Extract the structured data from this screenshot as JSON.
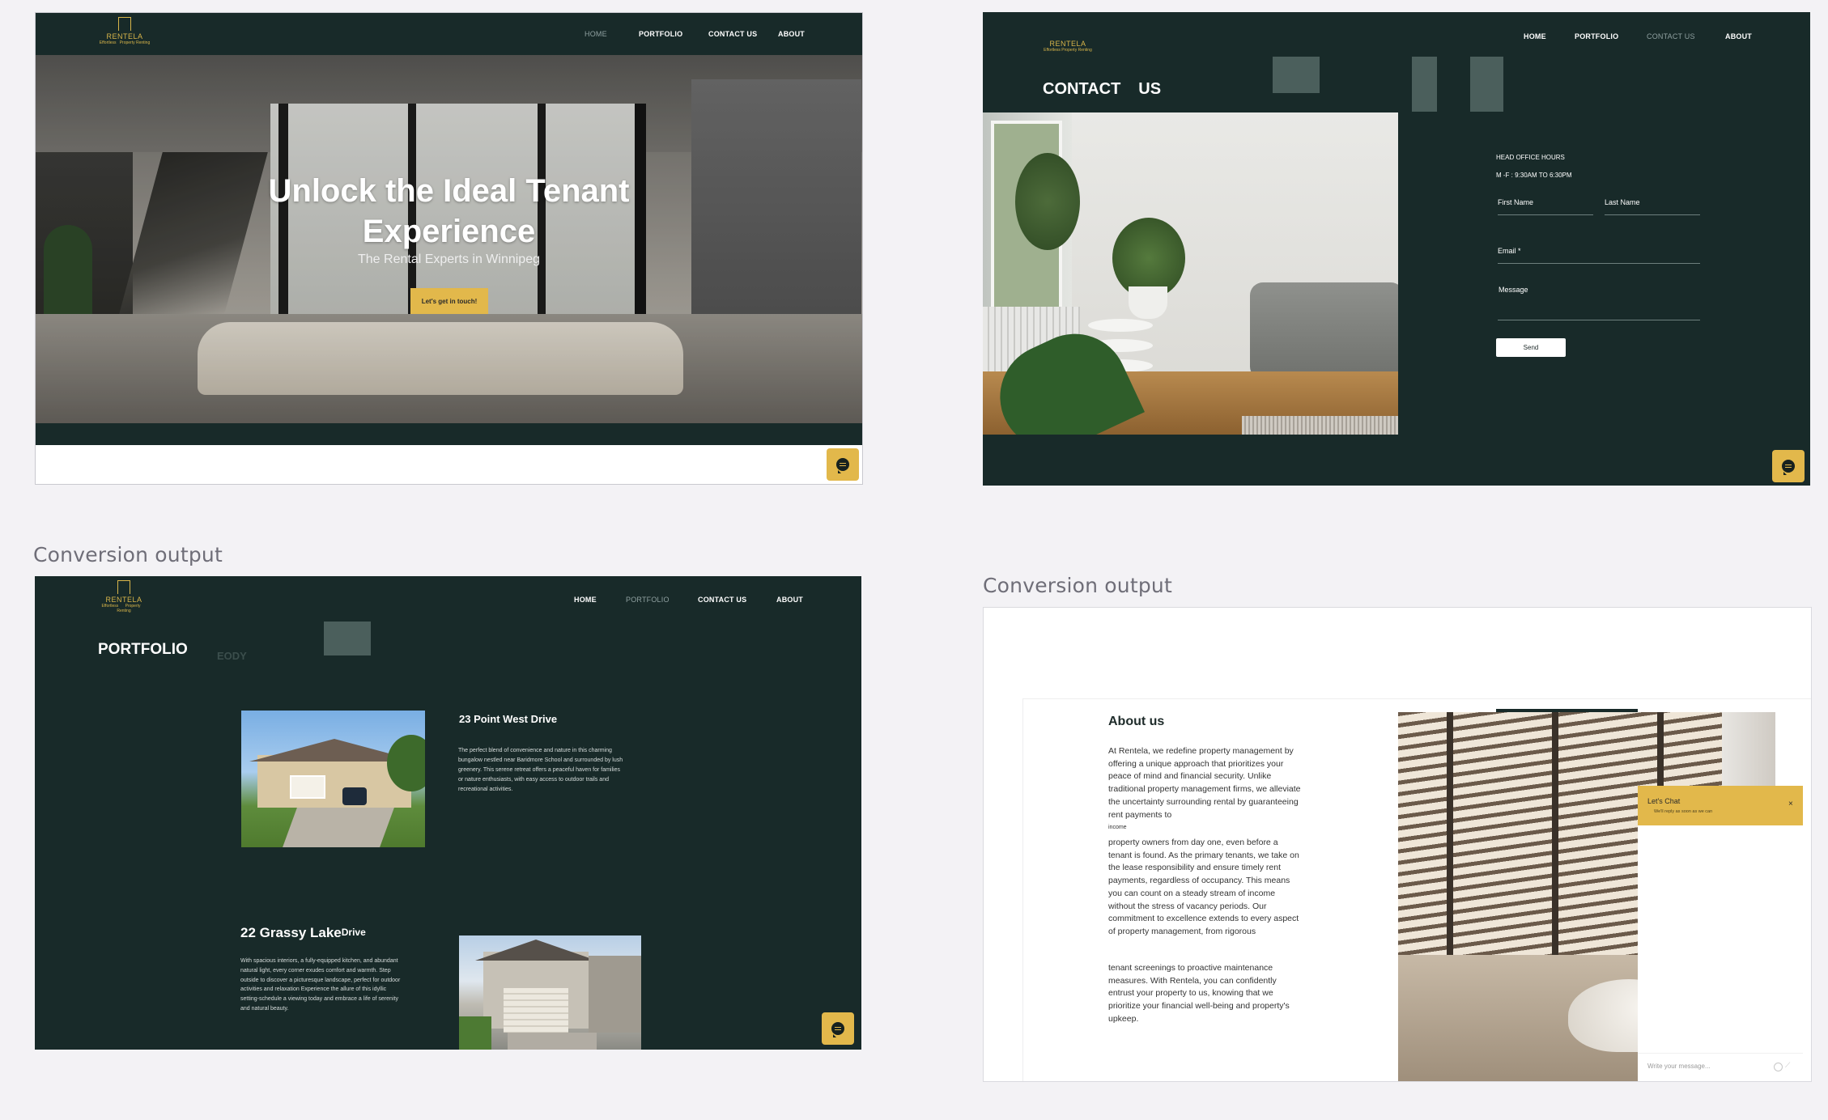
{
  "captions": {
    "bottom_left": "Conversion output",
    "bottom_right": "Conversion output"
  },
  "brand": {
    "name": "RENTELA",
    "tag1": "Effortless",
    "tag2": "Property",
    "tag3": "Renting",
    "tagline": "Effortless Property Renting",
    "gold": "#d8b54a",
    "dark_green": "#182a29"
  },
  "nav": {
    "home": "HOME",
    "portfolio": "PORTFOLIO",
    "contact": "CONTACT US",
    "about": "ABOUT"
  },
  "hero": {
    "title_line1": "Unlock the Ideal Tenant",
    "title_line2": "Experience",
    "subtitle": "The Rental Experts in Winnipeg",
    "cta": "Let's get in touch!"
  },
  "contact": {
    "title_word1": "CONTACT",
    "title_word2": "US",
    "office_hours_title": "HEAD OFFICE HOURS",
    "office_hours": "M -F : 9:30AM TO 6:30PM",
    "first_name": "First Name",
    "last_name": "Last Name",
    "email": "Email *",
    "message": "Message",
    "send": "Send"
  },
  "portfolio": {
    "title": "PORTFOLIO",
    "ghost_text": "EODY",
    "listings": [
      {
        "title": "23 Point West Drive",
        "text": "The perfect blend of convenience and nature in this charming bungalow nestled near Baridmore School and surrounded by lush greenery. This serene retreat offers a peaceful haven for families or nature enthusiasts, with easy access to outdoor trails and recreational activities."
      },
      {
        "title_main": "22 Grassy Lake",
        "title_suffix": "Drive",
        "text": "With spacious interiors, a fully-equipped kitchen, and abundant natural light, every corner exudes comfort and warmth. Step outside to discover a picturesque landscape, perfect for outdoor activities and relaxation Experience the allure of this idyllic setting-schedule a viewing today and embrace a life of serenity and natural beauty."
      }
    ]
  },
  "about": {
    "title": "About us",
    "para1": "At Rentela, we redefine property management by offering a unique approach that prioritizes your peace of mind and financial security. Unlike traditional property management firms, we alleviate the uncertainty surrounding rental by guaranteeing rent payments to",
    "stray": "income",
    "para2": "property owners from day one, even before a tenant is found. As the primary tenants, we take on the lease responsibility and ensure timely rent payments, regardless of occupancy. This means you can count on a steady stream of income without the stress of vacancy periods. Our commitment to excellence extends to every aspect of property management, from rigorous",
    "para3": "tenant screenings to proactive maintenance measures. With Rentela, you can confidently entrust your property to us, knowing that we prioritize your financial well-being and property's upkeep."
  },
  "chat_widget": {
    "title": "Let's Chat",
    "subtitle": "We'll reply as soon as we can",
    "close": "×",
    "placeholder": "Write your message..."
  }
}
